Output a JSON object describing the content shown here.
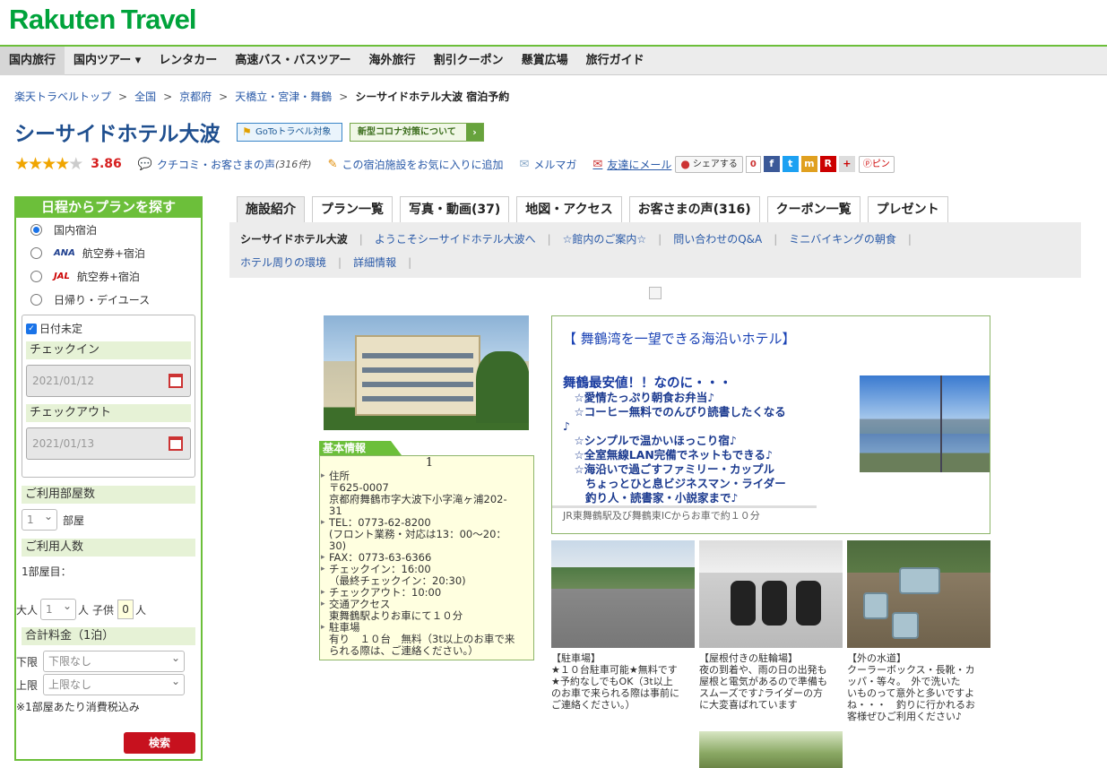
{
  "logo": {
    "part1": "Rakuten",
    "part2": "Travel"
  },
  "global_nav": [
    "国内旅行",
    "国内ツアー ▾",
    "レンタカー",
    "高速バス・バスツアー",
    "海外旅行",
    "割引クーポン",
    "懸賞広場",
    "旅行ガイド"
  ],
  "breadcrumb": {
    "links": [
      "楽天トラベルトップ",
      "全国",
      "京都府",
      "天橋立・宮津・舞鶴"
    ],
    "separator": ">",
    "current": "シーサイドホテル大波 宿泊予約"
  },
  "hotel": {
    "name": "シーサイドホテル大波",
    "goto_badge": "GoToトラベル対象",
    "covid_badge": "新型コロナ対策について",
    "rating_stars": 3.86,
    "rating": "3.86",
    "reviews_label": "クチコミ・お客さまの声",
    "reviews_count": "(316件)",
    "favorite": "この宿泊施設をお気に入りに追加",
    "mailmag": "メルマガ",
    "mail_friend": "友達にメール",
    "share": "シェアする",
    "share_count": "0",
    "pin": "ピン"
  },
  "social_icons": [
    "f",
    "t",
    "m",
    "R",
    "+"
  ],
  "sidebar": {
    "title": "日程からプランを探す",
    "plan_types": [
      {
        "prefix": "",
        "label": "国内宿泊",
        "selected": true
      },
      {
        "prefix": "ANA",
        "label": "航空券+宿泊",
        "selected": false
      },
      {
        "prefix": "JAL",
        "label": "航空券+宿泊",
        "selected": false
      },
      {
        "prefix": "",
        "label": "日帰り・デイユース",
        "selected": false
      }
    ],
    "date_undecided": "日付未定",
    "checkin_label": "チェックイン",
    "checkin_value": "2021/01/12",
    "checkout_label": "チェックアウト",
    "checkout_value": "2021/01/13",
    "rooms_label": "ご利用部屋数",
    "rooms_value": "1",
    "rooms_unit": "部屋",
    "people_label": "ご利用人数",
    "room1_label": "1部屋目：",
    "adult_label": "大人",
    "adult_value": "1",
    "adult_unit": "人",
    "child_label": "子供",
    "child_value": "0",
    "child_unit": "人",
    "price_label": "合計料金（1泊）",
    "min_label": "下限",
    "min_value": "下限なし",
    "max_label": "上限",
    "max_value": "上限なし",
    "tax_note": "※1部屋あたり消費税込み",
    "search_button": "検索"
  },
  "tabs": [
    "施設紹介",
    "プラン一覧",
    "写真・動画(37)",
    "地図・アクセス",
    "お客さまの声(316)",
    "クーポン一覧",
    "プレゼント"
  ],
  "subnav": {
    "row1": [
      "シーサイドホテル大波",
      "ようこそシーサイドホテル大波へ",
      "☆館内のご案内☆",
      "問い合わせのQ&A",
      "ミニバイキングの朝食"
    ],
    "row2": [
      "ホテル周りの環境",
      "詳細情報"
    ]
  },
  "basic_info": {
    "tab": "基本情報",
    "number": "1",
    "lines": [
      {
        "h": true,
        "t": "住所"
      },
      {
        "h": false,
        "t": "〒625-0007"
      },
      {
        "h": false,
        "t": "京都府舞鶴市字大波下小字滝ヶ浦202-"
      },
      {
        "h": false,
        "t": "31"
      },
      {
        "h": true,
        "t": "TEL：0773-62-8200"
      },
      {
        "h": false,
        "t": "(フロント業務・対応は13：00～20："
      },
      {
        "h": false,
        "t": "30)"
      },
      {
        "h": true,
        "t": "FAX：0773-63-6366"
      },
      {
        "h": true,
        "t": "チェックイン：16:00"
      },
      {
        "h": false,
        "t": "（最終チェックイン：20:30)"
      },
      {
        "h": true,
        "t": "チェックアウト：10:00"
      },
      {
        "h": true,
        "t": "交通アクセス"
      },
      {
        "h": false,
        "t": "東舞鶴駅よりお車にて１０分"
      },
      {
        "h": true,
        "t": "駐車場"
      },
      {
        "h": false,
        "t": "有り　１０台　無料（3t以上のお車で来"
      },
      {
        "h": false,
        "t": "られる際は、ご連絡ください。）"
      }
    ]
  },
  "feature": {
    "title": "【 舞鶴湾を一望できる海沿いホテル】",
    "headline": "舞鶴最安値！！なのに・・・",
    "lines": [
      "　☆愛情たっぷり朝食お弁当♪",
      "　☆コーヒー無料でのんびり読書したくなる",
      "♪",
      "　☆シンプルで温かいほっこり宿♪",
      "　☆全室無線LAN完備でネットもできる♪",
      "　☆海沿いで過ごすファミリー・カップル",
      "　　ちょっとひと息ビジネスマン・ライダー",
      "　　釣り人・読書家・小説家まで♪"
    ],
    "note": "JR東舞鶴駅及び舞鶴東ICからお車で約１０分"
  },
  "gallery": [
    {
      "caption": "【駐車場】\n★１０台駐車可能★無料です\n★予約なしでもOK（3t以上\nのお車で来られる際は事前に\nご連絡ください。）"
    },
    {
      "caption": "【屋根付きの駐輪場】\n夜の到着や、雨の日の出発も\n屋根と電気があるので準備も\nスムーズです♪ライダーの方\nに大変喜ばれています"
    },
    {
      "caption": "【外の水道】\nクーラーボックス・長靴・カ\nッパ・等々。　外で洗いた\nいものって意外と多いですよ\nね・・・　釣りに行かれるお\n客様ぜひご利用ください♪"
    }
  ]
}
